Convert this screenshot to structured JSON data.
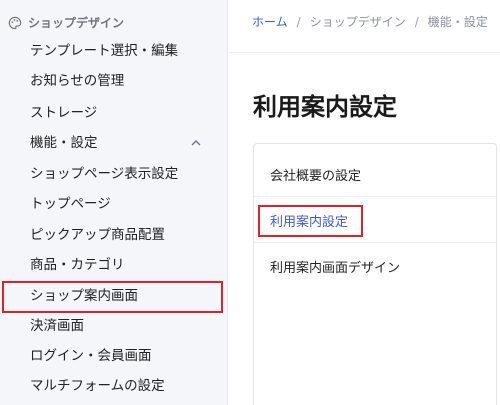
{
  "breadcrumb": {
    "home": "ホーム",
    "sep1": "/",
    "shop_design": "ショップデザイン",
    "sep2": "/",
    "current": "機能・設定"
  },
  "sidebar": {
    "section_title": "ショップデザイン",
    "section_icon": "palette-icon",
    "items": [
      {
        "label": "テンプレート選択・編集"
      },
      {
        "label": "お知らせの管理"
      },
      {
        "label": "ストレージ"
      },
      {
        "label": "機能・設定",
        "expanded": true,
        "icon": "chevron-up-icon"
      },
      {
        "label": "ショップページ表示設定"
      },
      {
        "label": "トップページ"
      },
      {
        "label": "ピックアップ商品配置"
      },
      {
        "label": "商品・カテゴリ"
      },
      {
        "label": "ショップ案内画面",
        "highlighted": true
      },
      {
        "label": "決済画面"
      },
      {
        "label": "ログイン・会員画面"
      },
      {
        "label": "マルチフォームの設定"
      }
    ]
  },
  "main": {
    "title": "利用案内設定",
    "menu": [
      {
        "label": "会社概要の設定"
      },
      {
        "label": "利用案内設定",
        "active": true
      },
      {
        "label": "利用案内画面デザイン"
      }
    ]
  },
  "colors": {
    "accent": "#3b5bd8",
    "highlight_box": "#e0212a",
    "sidebar_bg": "#f5f6fa"
  }
}
